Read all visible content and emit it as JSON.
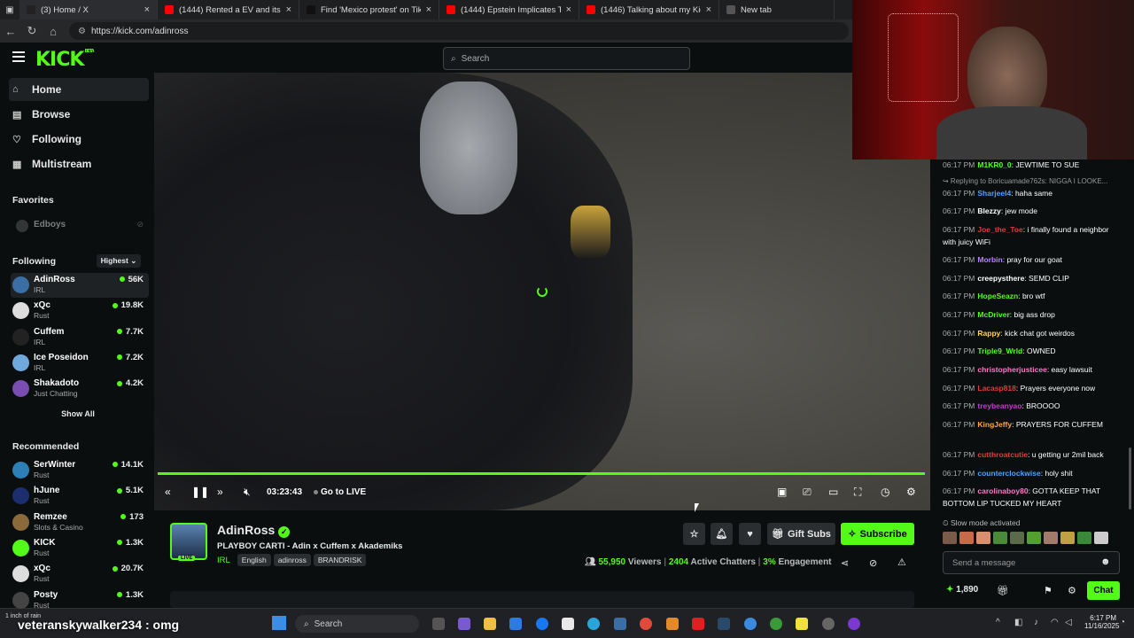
{
  "browser": {
    "tabs": [
      {
        "title": "(3) Home / X",
        "color": "#222222"
      },
      {
        "title": "(1444) Rented a EV and its to say",
        "color": "#ff0000"
      },
      {
        "title": "Find 'Mexico protest' on TikTok |",
        "color": "#111111"
      },
      {
        "title": "(1444) Epstein Implicates Trump",
        "color": "#ff0000"
      },
      {
        "title": "(1446) Talking about my Kick Ban",
        "color": "#ff0000"
      },
      {
        "title": "New tab",
        "color": "#555555"
      }
    ],
    "url": "https://kick.com/adinross"
  },
  "kick": {
    "logo": "KICK",
    "logo_badge": "BETA",
    "search_placeholder": "Search",
    "nav": [
      {
        "label": "Home",
        "icon": "home-icon",
        "glyph": "⌂"
      },
      {
        "label": "Browse",
        "icon": "browse-icon",
        "glyph": "▤"
      },
      {
        "label": "Following",
        "icon": "heart-icon",
        "glyph": "♡"
      },
      {
        "label": "Multistream",
        "icon": "grid-icon",
        "glyph": "▦"
      }
    ],
    "favorites_label": "Favorites",
    "favorite_channel": "Edboys",
    "following_label": "Following",
    "following_sort": "Highest",
    "following": [
      {
        "name": "AdinRoss",
        "game": "IRL",
        "viewers": "56K",
        "color": "#3a6ea5"
      },
      {
        "name": "xQc",
        "game": "Rust",
        "viewers": "19.8K",
        "color": "#dddddd"
      },
      {
        "name": "Cuffem",
        "game": "IRL",
        "viewers": "7.7K",
        "color": "#222222"
      },
      {
        "name": "Ice Poseidon",
        "game": "IRL",
        "viewers": "7.2K",
        "color": "#6fa8dc"
      },
      {
        "name": "Shakadoto",
        "game": "Just Chatting",
        "viewers": "4.2K",
        "color": "#7a4db0"
      }
    ],
    "show_all": "Show All",
    "recommended_label": "Recommended",
    "recommended": [
      {
        "name": "SerWinter",
        "game": "Rust",
        "viewers": "14.1K",
        "color": "#2d7fb8"
      },
      {
        "name": "hJune",
        "game": "Rust",
        "viewers": "5.1K",
        "color": "#1c2e6e"
      },
      {
        "name": "Remzee",
        "game": "Slots & Casino",
        "viewers": "173",
        "color": "#8a6a3a"
      },
      {
        "name": "KICK",
        "game": "Rust",
        "viewers": "1.3K",
        "color": "#53fc18"
      },
      {
        "name": "xQc",
        "game": "Rust",
        "viewers": "20.7K",
        "color": "#dddddd"
      },
      {
        "name": "Posty",
        "game": "Rust",
        "viewers": "1.3K",
        "color": "#444444"
      }
    ]
  },
  "player": {
    "time": "03:23:43",
    "go_live": "Go to LIVE",
    "progress": 1.0
  },
  "stream": {
    "channel": "AdinRoss",
    "live_badge": "LIVE",
    "title": "PLAYBOY CARTI - Adin x Cuffem x Akademiks",
    "category": "IRL",
    "tags": [
      "English",
      "adinross",
      "BRANDRISK"
    ],
    "viewers": "55,950",
    "viewers_label": "Viewers",
    "chatters": "2404",
    "chatters_label": "Active Chatters",
    "engagement": "3%",
    "engagement_label": "Engagement",
    "gift_subs": "Gift Subs",
    "subscribe": "Subscribe"
  },
  "chat": {
    "messages": [
      {
        "time": "06:17 PM",
        "user": "M1KR0_0",
        "color": "#53fc18",
        "text": "JEWTIME TO SUE"
      },
      {
        "time": "",
        "user": "",
        "color": "#999999",
        "text": "↪ Replying to Boricuamade762s: NIGGA I LOOKE..."
      },
      {
        "time": "06:17 PM",
        "user": "Sharjeel4",
        "color": "#4aa3ff",
        "text": "haha same"
      },
      {
        "time": "06:17 PM",
        "user": "Blezzy",
        "color": "#ffffff",
        "text": "jew mode"
      },
      {
        "time": "06:17 PM",
        "user": "Joe_the_Toe",
        "color": "#e03b3b",
        "text": "i finally found a neighbor with juicy WiFi"
      },
      {
        "time": "06:17 PM",
        "user": "Morbin",
        "color": "#b583ff",
        "text": "pray for our goat"
      },
      {
        "time": "06:17 PM",
        "user": "creepysthere",
        "color": "#ffffff",
        "text": "SEMD CLIP"
      },
      {
        "time": "06:17 PM",
        "user": "HopeSeazn",
        "color": "#53fc18",
        "text": "bro wtf"
      },
      {
        "time": "06:17 PM",
        "user": "McDriver",
        "color": "#53fc18",
        "text": "big ass drop"
      },
      {
        "time": "06:17 PM",
        "user": "Rappy",
        "color": "#ffd54a",
        "text": "kick chat got weirdos"
      },
      {
        "time": "06:17 PM",
        "user": "Triple9_Wrld",
        "color": "#53fc18",
        "text": "OWNED"
      },
      {
        "time": "06:17 PM",
        "user": "christopherjusticee",
        "color": "#ff77c8",
        "text": "easy lawsuit"
      },
      {
        "time": "06:17 PM",
        "user": "Lacasp818",
        "color": "#e03b3b",
        "text": "Prayers everyone now"
      },
      {
        "time": "06:17 PM",
        "user": "treybeanyao",
        "color": "#c83bd0",
        "text": "BROOOO"
      },
      {
        "time": "06:17 PM",
        "user": "KingJeffy",
        "color": "#ffa640",
        "text": "PRAYERS FOR CUFFEM"
      },
      {
        "time": "06:17 PM",
        "user": "cutthroatcutie",
        "color": "#e03b3b",
        "text": "u getting ur 2mil back"
      },
      {
        "time": "06:17 PM",
        "user": "counterclockwise",
        "color": "#4aa3ff",
        "text": "holy shit"
      },
      {
        "time": "06:17 PM",
        "user": "carolinaboy80",
        "color": "#ff77c8",
        "text": "GOTTA KEEP THAT BOTTOM LIP TUCKED MY HEART"
      }
    ],
    "slow_mode": "Slow mode activated",
    "input_placeholder": "Send a message",
    "points": "1,890",
    "chat_button": "Chat"
  },
  "overlay": {
    "weather": "1 inch of rain",
    "chat_line": "veteranskywalker234 : omg"
  },
  "taskbar": {
    "search": "Search",
    "time": "6:17 PM",
    "date": "11/16/2025"
  }
}
